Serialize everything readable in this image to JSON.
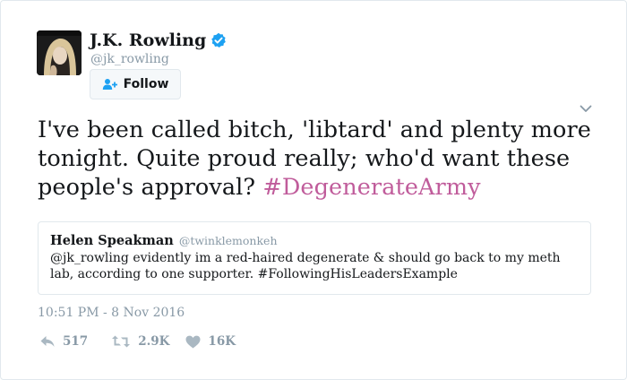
{
  "author": {
    "display_name": "J.K. Rowling",
    "handle": "@jk_rowling",
    "verified": true,
    "avatar_icon": "profile-photo"
  },
  "follow_button": {
    "label": "Follow",
    "icon": "add-user-icon"
  },
  "menu": {
    "icon": "chevron-down-icon"
  },
  "tweet": {
    "text": "I've been called bitch, 'libtard' and plenty more tonight. Quite proud really; who'd want these people's approval? ",
    "hashtag": "#DegenerateArmy"
  },
  "quoted_tweet": {
    "display_name": "Helen Speakman",
    "handle": "@twinklemonkeh",
    "text": "@jk_rowling evidently im a red-haired degenerate & should go back to my meth lab, according to one supporter. #FollowingHisLeadersExample"
  },
  "timestamp": "10:51 PM - 8 Nov 2016",
  "actions": {
    "reply_count": "517",
    "retweet_count": "2.9K",
    "like_count": "16K"
  },
  "colors": {
    "hashtag": "#c05c9b",
    "verified": "#1da1f2",
    "secondary_text": "#8899a6",
    "border": "#e1e8ed"
  }
}
